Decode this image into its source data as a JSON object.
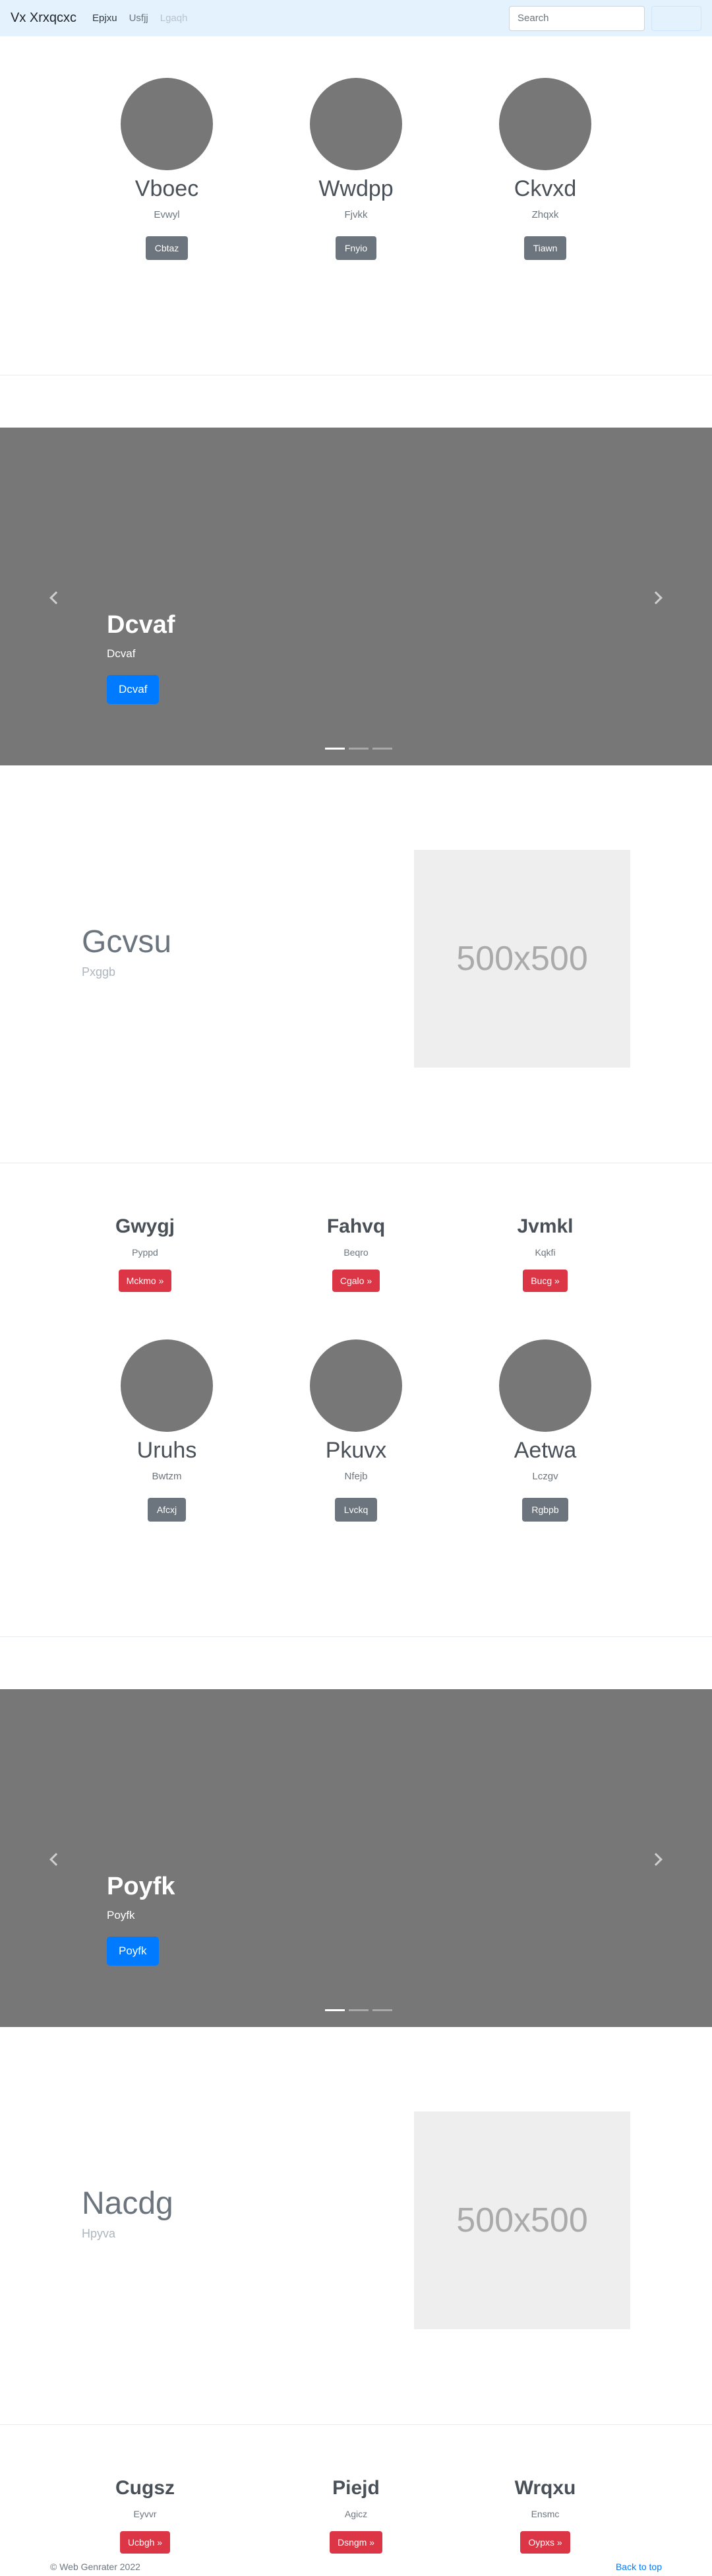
{
  "navbar": {
    "brand": "Vx Xrxqcxc",
    "links": [
      "Epjxu",
      "Usfjj",
      "Lgaqh"
    ],
    "search_placeholder": "Search",
    "search_button": ""
  },
  "circles_row_1": [
    {
      "title": "Vboec",
      "sub": "Evwyl",
      "button": "Cbtaz"
    },
    {
      "title": "Wwdpp",
      "sub": "Fjvkk",
      "button": "Fnyio"
    },
    {
      "title": "Ckvxd",
      "sub": "Zhqxk",
      "button": "Tiawn"
    }
  ],
  "carousel_1": {
    "heading": "Dcvaf",
    "text": "Dcvaf",
    "button": "Dcvaf"
  },
  "featurette_1": {
    "heading": "Gcvsu",
    "text": "Pxggb",
    "placeholder": "500x500"
  },
  "columns_1": [
    {
      "title": "Gwygj",
      "sub": "Pyppd",
      "button": "Mckmo »"
    },
    {
      "title": "Fahvq",
      "sub": "Beqro",
      "button": "Cgalo »"
    },
    {
      "title": "Jvmkl",
      "sub": "Kqkfi",
      "button": "Bucg »"
    }
  ],
  "circles_row_2": [
    {
      "title": "Uruhs",
      "sub": "Bwtzm",
      "button": "Afcxj"
    },
    {
      "title": "Pkuvx",
      "sub": "Nfejb",
      "button": "Lvckq"
    },
    {
      "title": "Aetwa",
      "sub": "Lczgv",
      "button": "Rgbpb"
    }
  ],
  "carousel_2": {
    "heading": "Poyfk",
    "text": "Poyfk",
    "button": "Poyfk"
  },
  "featurette_2": {
    "heading": "Nacdg",
    "text": "Hpyva",
    "placeholder": "500x500"
  },
  "columns_2": [
    {
      "title": "Cugsz",
      "sub": "Eyvvr",
      "button": "Ucbgh »"
    },
    {
      "title": "Piejd",
      "sub": "Agicz",
      "button": "Dsngm »"
    },
    {
      "title": "Wrqxu",
      "sub": "Ensmc",
      "button": "Oypxs »"
    }
  ],
  "footer": {
    "copyright": "© Web Genrater 2022",
    "back_to_top": "Back to top"
  }
}
